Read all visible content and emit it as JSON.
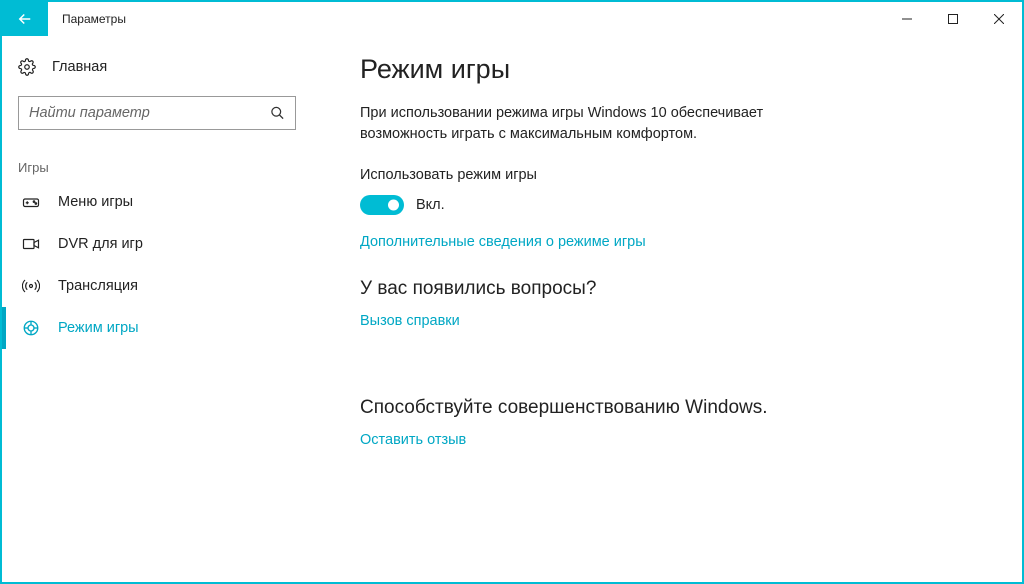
{
  "titlebar": {
    "title": "Параметры"
  },
  "sidebar": {
    "home": "Главная",
    "search_placeholder": "Найти параметр",
    "section": "Игры",
    "items": [
      {
        "label": "Меню игры"
      },
      {
        "label": "DVR для игр"
      },
      {
        "label": "Трансляция"
      },
      {
        "label": "Режим игры"
      }
    ]
  },
  "content": {
    "heading": "Режим игры",
    "description": "При использовании режима игры Windows 10 обеспечивает возможность играть с максимальным комфортом.",
    "toggle_label": "Использовать режим игры",
    "toggle_state": "Вкл.",
    "more_link": "Дополнительные сведения о режиме игры",
    "questions_heading": "У вас появились вопросы?",
    "help_link": "Вызов справки",
    "improve_heading": "Способствуйте совершенствованию Windows.",
    "feedback_link": "Оставить отзыв"
  }
}
